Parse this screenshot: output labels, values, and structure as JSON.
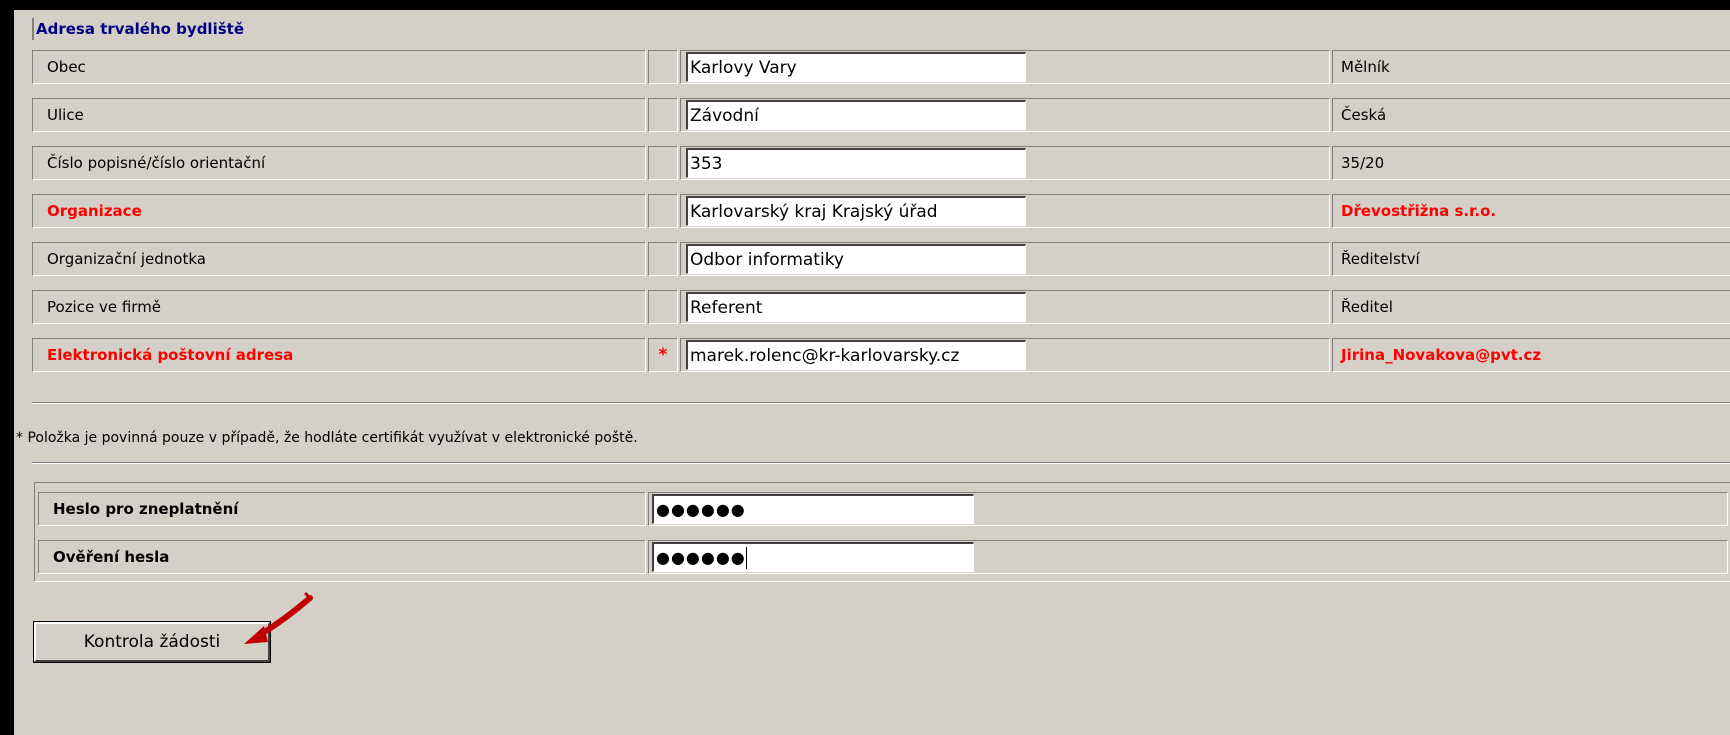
{
  "section": {
    "title": "Adresa trvalého bydliště"
  },
  "rows": [
    {
      "label": "Obec",
      "required": false,
      "value": "Karlovy Vary",
      "compare": "Mělník",
      "red": false
    },
    {
      "label": "Ulice",
      "required": false,
      "value": "Závodní",
      "compare": "Česká",
      "red": false
    },
    {
      "label": "Číslo popisné/číslo orientační",
      "required": false,
      "value": "353",
      "compare": "35/20",
      "red": false
    },
    {
      "label": "Organizace",
      "required": false,
      "value": "Karlovarský kraj Krajský úřad",
      "compare": "Dřevostřižna s.r.o.",
      "red": true
    },
    {
      "label": "Organizační jednotka",
      "required": false,
      "value": "Odbor informatiky",
      "compare": "Ředitelství",
      "red": false
    },
    {
      "label": "Pozice ve firmě",
      "required": false,
      "value": "Referent",
      "compare": "Ředitel",
      "red": false
    },
    {
      "label": "Elektronická poštovní adresa",
      "required": true,
      "required_mark": "*",
      "value": "marek.rolenc@kr-karlovarsky.cz",
      "compare": "Jirina_Novakova@pvt.cz",
      "red": true
    }
  ],
  "note": "* Položka je povinná pouze v případě, že hodláte certifikát využívat v elektronické poště.",
  "password": {
    "label": "Heslo pro zneplatnění",
    "value": "●●●●●●"
  },
  "password_confirm": {
    "label": "Ověření hesla",
    "value": "●●●●●●"
  },
  "submit": {
    "label": "Kontrola žádosti"
  },
  "colors": {
    "required_red": "#ff0000",
    "section_blue": "#000080",
    "panel_bg": "#d4d0c8",
    "annotation_arrow": "#c00000"
  }
}
